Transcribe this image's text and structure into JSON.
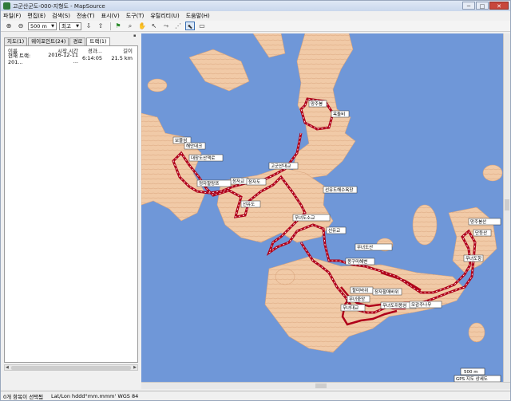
{
  "window": {
    "title": "고군산군도-000-지형도 - MapSource"
  },
  "menu": [
    "파일(F)",
    "편집(E)",
    "검색(S)",
    "전송(T)",
    "표시(V)",
    "도구(T)",
    "유틸리티(U)",
    "도움말(H)"
  ],
  "toolbar": {
    "zoom_value": "500 m",
    "detail_value": "최고"
  },
  "tabs": [
    "지도(1)",
    "웨이포인트(24)",
    "경로",
    "트랙(1)"
  ],
  "list": {
    "headers": [
      "이름",
      "시작 시간",
      "경과...",
      "길이"
    ],
    "rows": [
      {
        "name": "현재 트랙: 201...",
        "start": "2016-12-11 ...",
        "elapsed": "6:14:05",
        "length": "21.5 km"
      }
    ]
  },
  "map": {
    "scale_label": "500 m",
    "detail_label": "GPS 지도 상세도",
    "waypoints": [
      "망주봉",
      "옥돌비",
      "보물섬",
      "해안데크",
      "대장도산책로",
      "고군산대교",
      "장자교",
      "장자도",
      "정자할망쯔",
      "선유도",
      "신시도",
      "선유도해수욕장",
      "선유교",
      "무녀도소교",
      "몽구미해변",
      "무녀도산",
      "할미바위",
      "장자할매바위",
      "무녀중앙",
      "무녀대교",
      "무녀도쥐똥섬",
      "모감주나무",
      "단등산",
      "무녀도항",
      "망주봉산",
      "등산로"
    ]
  },
  "status": {
    "selected": "0개 항목이 선택됨",
    "coords": "Lat/Lon hddd°mm.mmm' WGS 84"
  }
}
